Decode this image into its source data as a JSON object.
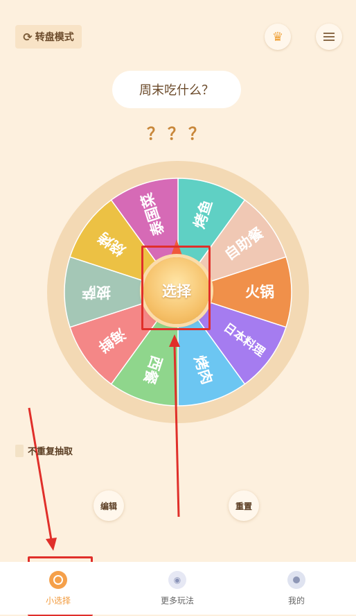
{
  "header": {
    "mode_icon": "refresh-icon",
    "mode_label": "转盘模式",
    "vip_icon": "crown-icon",
    "menu_icon": "list-icon"
  },
  "question": "周末吃什么？",
  "result": "？？？",
  "wheel": {
    "center_label": "选择",
    "segments": [
      {
        "label": "烤鱼",
        "color": "#5fd0c4"
      },
      {
        "label": "自助餐",
        "color": "#f0c8b4"
      },
      {
        "label": "火锅",
        "color": "#f0904a"
      },
      {
        "label": "日本料理",
        "color": "#a57cf0"
      },
      {
        "label": "烤肉",
        "color": "#6cc6f2"
      },
      {
        "label": "西餐",
        "color": "#8fd68c"
      },
      {
        "label": "海鲜",
        "color": "#f48787"
      },
      {
        "label": "披萨",
        "color": "#a4c7b6"
      },
      {
        "label": "烧烤",
        "color": "#ecc144"
      },
      {
        "label": "泰国菜",
        "color": "#d66ab6"
      }
    ],
    "rim_color": "#f3d9b4",
    "pointer_color": "#ef5a3c"
  },
  "no_repeat_label": "不重复抽取",
  "edit_label": "编辑",
  "reset_label": "重置",
  "tabs": [
    {
      "label": "小选择",
      "icon": "target-icon",
      "active": true
    },
    {
      "label": "更多玩法",
      "icon": "gamepad-icon",
      "active": false
    },
    {
      "label": "我的",
      "icon": "user-icon",
      "active": false
    }
  ],
  "accent_color": "#f29a3c",
  "annotation_color": "#e02f2a"
}
